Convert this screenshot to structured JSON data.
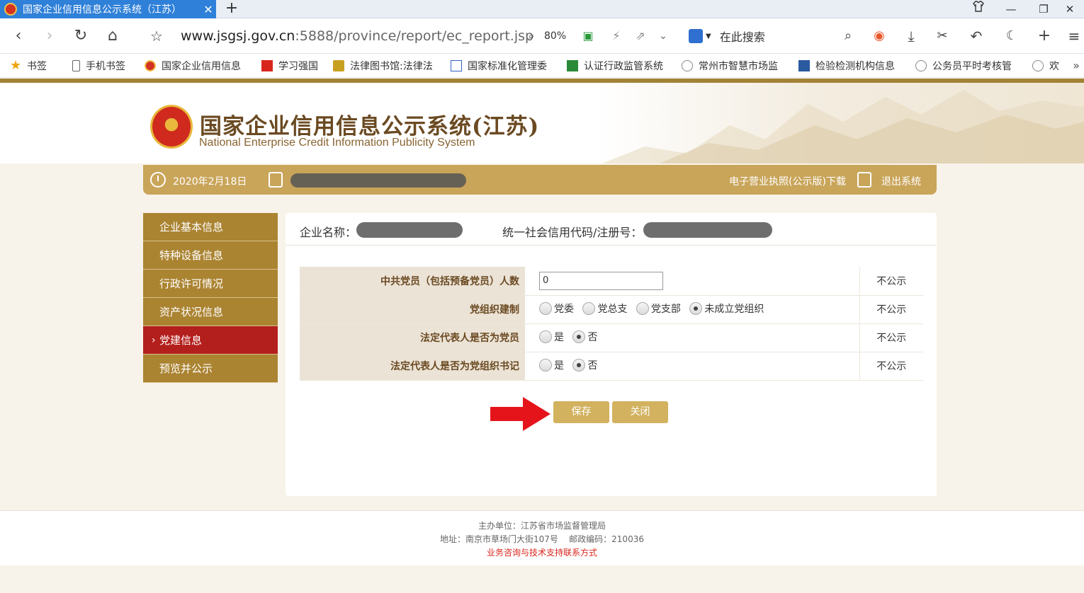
{
  "browser": {
    "tab_title": "国家企业信用信息公示系统（江苏）",
    "tab_close": "✕",
    "new_tab": "+",
    "url_host": "www.jsgsj.gov.cn",
    "url_rest": ":5888/province/report/ec_report.jsp",
    "zoom": "80%",
    "search_placeholder": "在此搜索"
  },
  "bookmarks": [
    {
      "label": "书签",
      "color": "#f0a30a"
    },
    {
      "label": "手机书签",
      "color": "#666666"
    },
    {
      "label": "国家企业信用信息",
      "color": "#d43222"
    },
    {
      "label": "学习强国",
      "color": "#d9261c"
    },
    {
      "label": "法律图书馆:法律法",
      "color": "#c8a020"
    },
    {
      "label": "国家标准化管理委",
      "color": "#3060c0"
    },
    {
      "label": "认证行政监管系统",
      "color": "#2a8a3a"
    },
    {
      "label": "常州市智慧市场监",
      "color": "#888888"
    },
    {
      "label": "检验检测机构信息",
      "color": "#2a5aa0"
    },
    {
      "label": "公务员平时考核管",
      "color": "#888888"
    },
    {
      "label": "欢",
      "color": "#888888"
    }
  ],
  "site": {
    "logo_cn": "国家企业信用信息公示系统(江苏)",
    "logo_en": "National Enterprise Credit Information Publicity System"
  },
  "goldbar": {
    "date": "2020年2月18日",
    "license_link": "电子营业执照(公示版)下载",
    "exit_link": "退出系统"
  },
  "sidebar": {
    "items": [
      {
        "label": "企业基本信息"
      },
      {
        "label": "特种设备信息"
      },
      {
        "label": "行政许可情况"
      },
      {
        "label": "资产状况信息"
      },
      {
        "label": "党建信息"
      },
      {
        "label": "预览并公示"
      }
    ],
    "active_index": 4
  },
  "main": {
    "company_label": "企业名称：",
    "credit_code_label": "统一社会信用代码/注册号："
  },
  "form": {
    "rows": [
      {
        "label": "中共党员（包括预备党员）人数",
        "value": "0",
        "publicity": "不公示"
      },
      {
        "label": "党组织建制",
        "options": [
          "党委",
          "党总支",
          "党支部",
          "未成立党组织"
        ],
        "selected": "未成立党组织",
        "publicity": "不公示"
      },
      {
        "label": "法定代表人是否为党员",
        "options": [
          "是",
          "否"
        ],
        "selected": "否",
        "publicity": "不公示"
      },
      {
        "label": "法定代表人是否为党组织书记",
        "options": [
          "是",
          "否"
        ],
        "selected": "否",
        "publicity": "不公示"
      }
    ]
  },
  "buttons": {
    "save": "保存",
    "close": "关闭"
  },
  "footer": {
    "host": "主办单位：江苏省市场监督管理局",
    "address": "地址：南京市草场门大街107号    邮政编码：210036",
    "support": "业务咨询与技术支持联系方式"
  },
  "colors": {
    "gold": "#c9a55a",
    "menu": "#ab8432",
    "active": "#b31f1c",
    "button": "#d2b25f",
    "arrow": "#e5141b"
  }
}
